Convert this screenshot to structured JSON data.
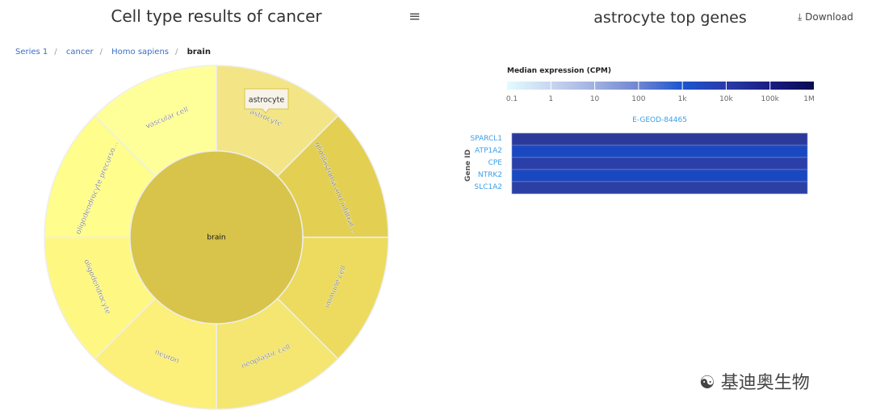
{
  "left": {
    "title": "Cell type results of cancer",
    "menu_icon": "hamburger-icon",
    "breadcrumb": [
      "Series 1",
      "cancer",
      "Homo sapiens",
      "brain"
    ],
    "tooltip": "astrocyte"
  },
  "chart_data": [
    {
      "type": "sunburst",
      "center": {
        "label": "brain",
        "color": "#d8c44a"
      },
      "segments": [
        {
          "label": "astrocyte",
          "value": 1,
          "color": "#f3e585"
        },
        {
          "label": "glioblastoma and infiltrat...",
          "value": 1,
          "color": "#e3d052"
        },
        {
          "label": "immune cell",
          "value": 1,
          "color": "#ecdb5e"
        },
        {
          "label": "neoplastic cell",
          "value": 1,
          "color": "#f4e670"
        },
        {
          "label": "neuron",
          "value": 1,
          "color": "#fcef7a"
        },
        {
          "label": "oligodendrocyte",
          "value": 1,
          "color": "#fef883"
        },
        {
          "label": "oligodendrocyte precurso...",
          "value": 1,
          "color": "#fffd8c"
        },
        {
          "label": "vascular cell",
          "value": 1,
          "color": "#ffff99"
        }
      ]
    },
    {
      "type": "heatmap",
      "title": "astrocyte top genes",
      "legend_title": "Median expression (CPM)",
      "legend_ticks": [
        "0.1",
        "1",
        "10",
        "100",
        "1k",
        "10k",
        "100k",
        "1M"
      ],
      "legend_colors": [
        "#e0fcff",
        "#c9d6ef",
        "#9fb0e0",
        "#6f85d0",
        "#1b55d0",
        "#2a3aa8",
        "#1a1c82",
        "#0a0a52"
      ],
      "x_categories": [
        "E-GEOD-84465"
      ],
      "ylabel": "Gene ID",
      "genes": [
        "SPARCL1",
        "ATP1A2",
        "CPE",
        "NTRK2",
        "SLC1A2"
      ],
      "cell_colors": [
        "#2b3a9a",
        "#1a48c0",
        "#2a40a8",
        "#1a48c0",
        "#2b3fa4"
      ]
    }
  ],
  "right": {
    "download_label": "Download",
    "download_icon": "download-icon"
  },
  "watermark": "基迪奥生物"
}
